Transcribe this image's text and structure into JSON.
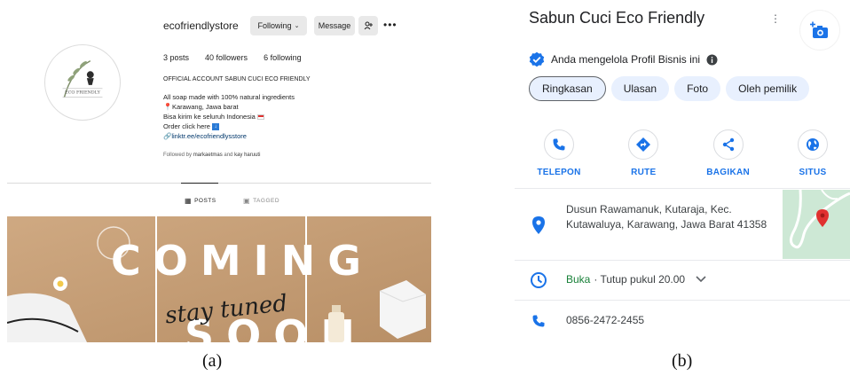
{
  "panel_a": {
    "username": "ecofriendlystore",
    "following_label": "Following",
    "message_label": "Message",
    "stats": {
      "posts": "3 posts",
      "followers": "40 followers",
      "following": "6 following"
    },
    "full_name": "OFFICIAL ACCOUNT SABUN CUCI ECO FRIENDLY",
    "bio_lines": [
      "All soap made with 100% natural ingredients",
      "Karawang, Jawa barat",
      "Bisa kirim ke seluruh Indonesia",
      "Order click here",
      "linktr.ee/ecofriendlysstore"
    ],
    "followed_by_prefix": "Followed by",
    "followed_by_user1": "markaetmas",
    "followed_by_and": "and",
    "followed_by_user2": "kay haruuti",
    "tabs": {
      "posts": "POSTS",
      "tagged": "TAGGED"
    },
    "logo_text": "ECO FRIENDLY",
    "post_text": {
      "coming": "COMING",
      "soon": "SOON",
      "stay_tuned": "stay tuned"
    }
  },
  "panel_b": {
    "title": "Sabun Cuci Eco Friendly",
    "verified_text": "Anda mengelola Profil Bisnis ini",
    "chips": [
      "Ringkasan",
      "Ulasan",
      "Foto",
      "Oleh pemilik"
    ],
    "actions": [
      "TELEPON",
      "RUTE",
      "BAGIKAN",
      "SITUS"
    ],
    "address": "Dusun Rawamanuk, Kutaraja, Kec. Kutawaluya, Karawang, Jawa Barat 41358",
    "hours_status": "Buka",
    "hours_detail": "· Tutup pukul 20.00",
    "phone": "0856-2472-2455"
  },
  "captions": {
    "a": "(a)",
    "b": "(b)"
  },
  "colors": {
    "maps_blue": "#1a73e8",
    "open_green": "#188038",
    "pin_red": "#e0312f"
  }
}
